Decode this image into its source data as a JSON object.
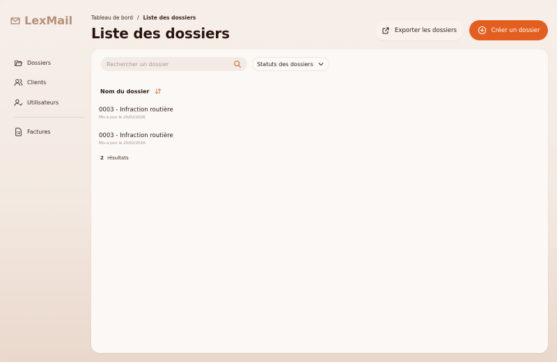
{
  "app": {
    "name": "LexMail",
    "logo_icon": "mail-icon"
  },
  "colors": {
    "accent": "#e35f1f",
    "logo": "#b6907b",
    "text": "#2a1a14"
  },
  "sidebar": {
    "items": [
      {
        "label": "Dossiers",
        "icon": "folder-icon"
      },
      {
        "label": "Clients",
        "icon": "users-icon"
      },
      {
        "label": "Utilisateurs",
        "icon": "user-check-icon"
      },
      {
        "label": "Factures",
        "icon": "invoice-icon"
      }
    ]
  },
  "header": {
    "breadcrumb": {
      "parent": "Tableau de bord",
      "separator": "/",
      "current": "Liste des dossiers"
    },
    "title": "Liste des dossiers",
    "export_label": "Exporter les dossiers",
    "create_label": "Créer un dossier"
  },
  "filters": {
    "search_placeholder": "Rechercher un dossier",
    "search_value": "",
    "status_label": "Statuts des dossiers"
  },
  "table": {
    "column_name": "Nom du dossier",
    "rows": [
      {
        "name": "0003 - Infraction routière",
        "meta": "Mis à jour le 20/02/2026"
      },
      {
        "name": "0003 - Infraction routière",
        "meta": "Mis à jour le 20/02/2026"
      }
    ],
    "results_count": "2",
    "results_label": "résultats"
  }
}
